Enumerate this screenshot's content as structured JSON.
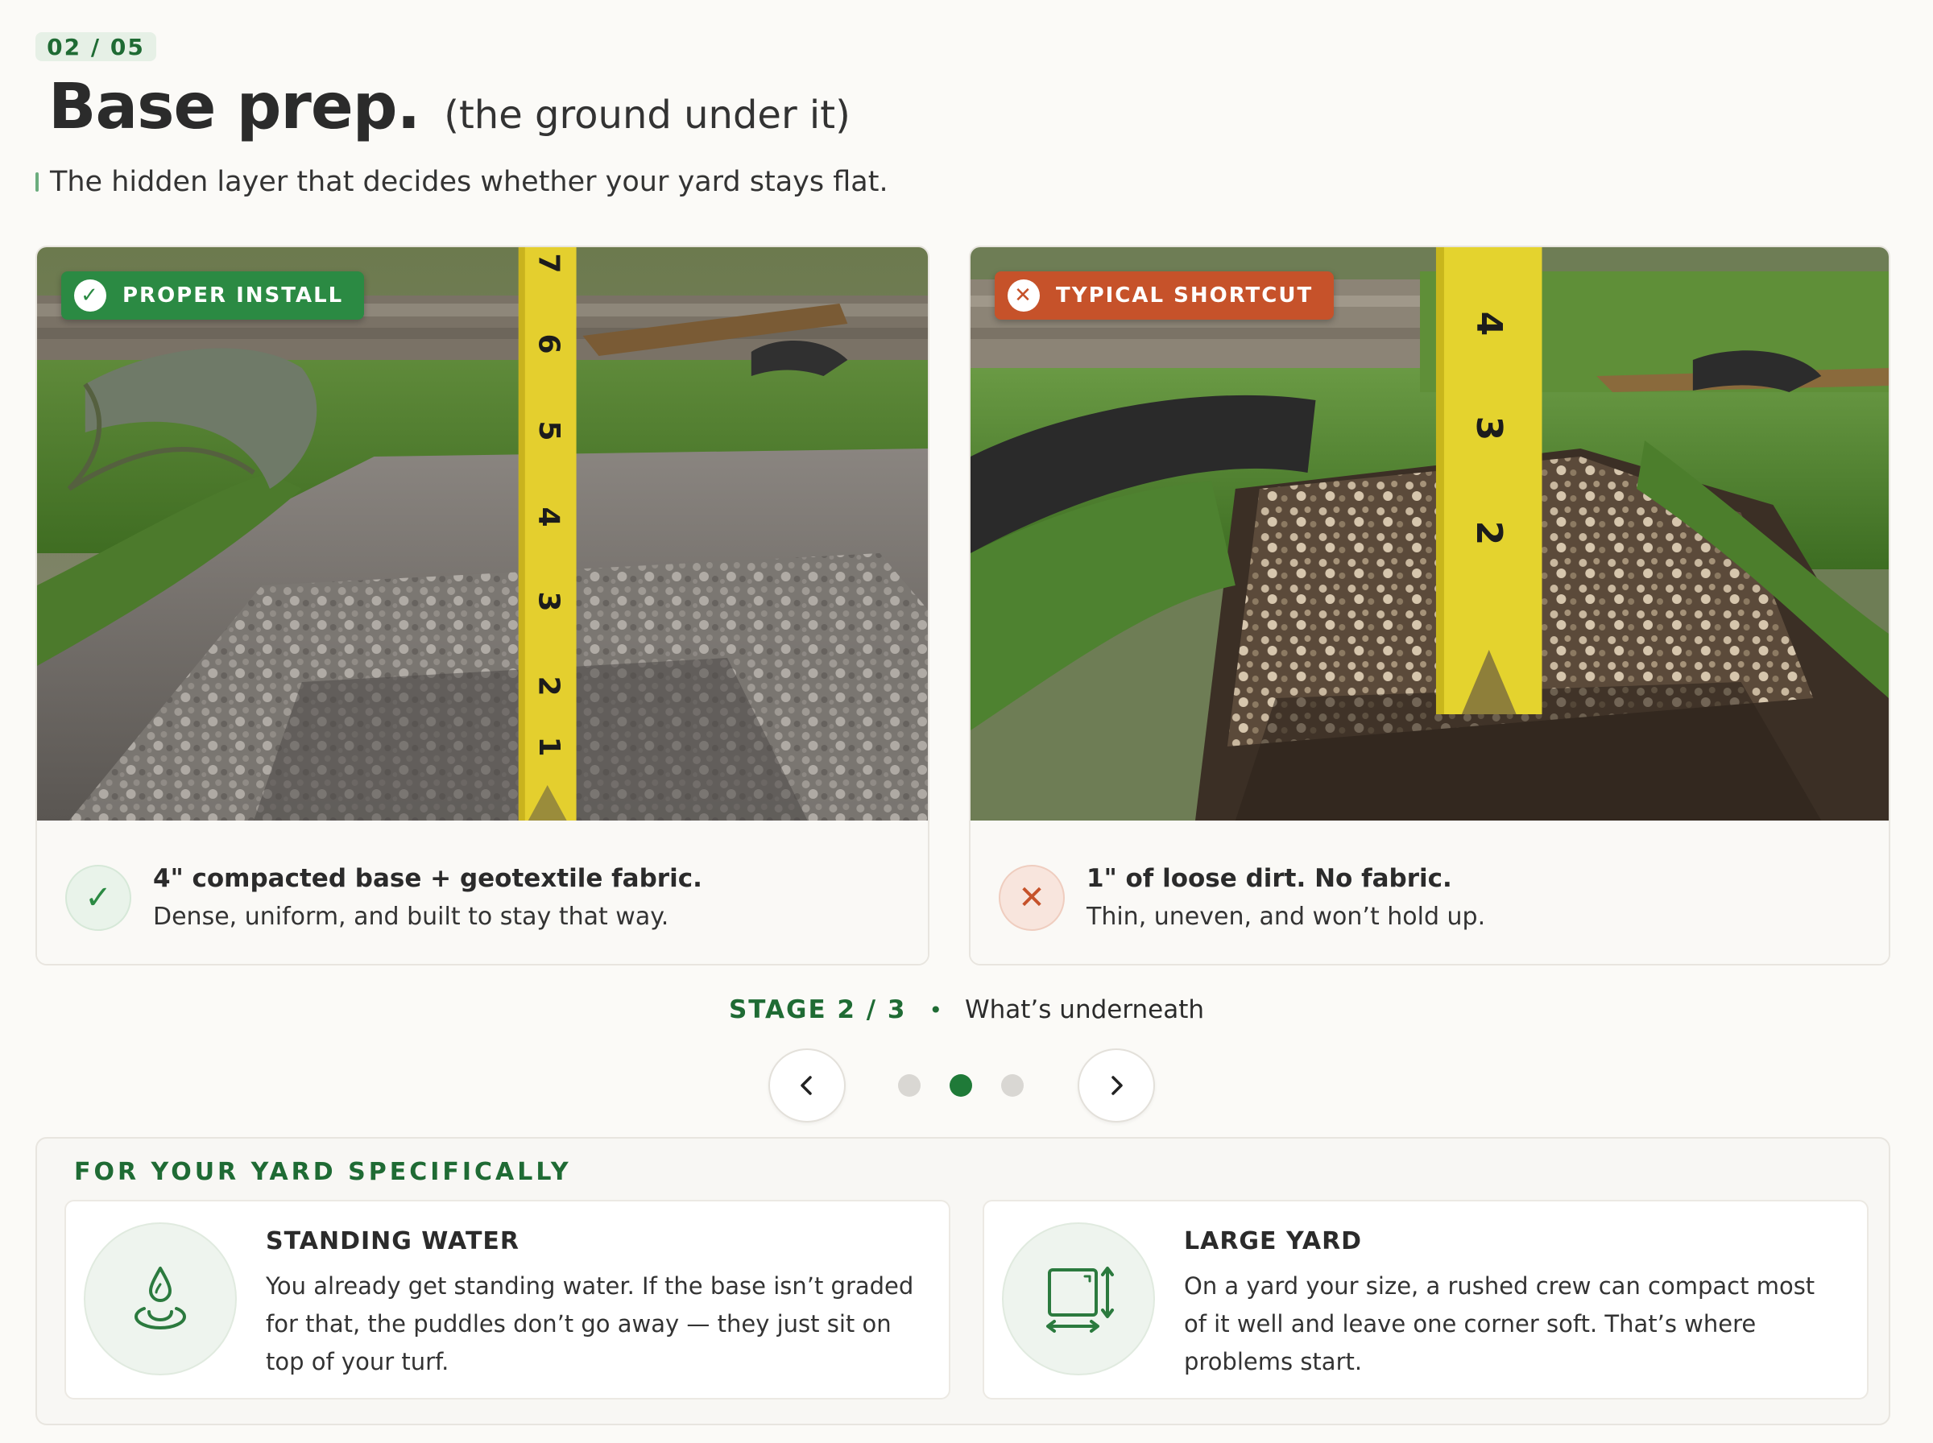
{
  "header": {
    "step": "02 / 05",
    "title": "Base prep.",
    "title_aside": "(the ground under it)",
    "subtitle": "The hidden layer that decides whether your yard stays flat."
  },
  "compare": {
    "proper": {
      "tag": "PROPER INSTALL",
      "tag_icon": "check-icon",
      "caption_head": "4\" compacted base + geotextile fabric.",
      "caption_body": "Dense, uniform, and built to stay that way.",
      "tape_numbers": [
        "7",
        "6",
        "5",
        "4",
        "3",
        "2",
        "1"
      ],
      "color": "#2b8a43"
    },
    "shortcut": {
      "tag": "TYPICAL SHORTCUT",
      "tag_icon": "x-icon",
      "caption_head": "1\" of loose dirt. No fabric.",
      "caption_body": "Thin, uneven, and won’t hold up.",
      "tape_numbers": [
        "4",
        "3",
        "2"
      ],
      "color": "#c6522a"
    }
  },
  "stage": {
    "number": "STAGE 2 / 3",
    "separator": "•",
    "label": "What’s underneath",
    "current": 2,
    "total": 3
  },
  "yard": {
    "title": "FOR YOUR YARD SPECIFICALLY",
    "items": [
      {
        "icon": "water-drop-icon",
        "head": "STANDING WATER",
        "body": "You already get standing water. If the base isn’t graded for that, the puddles don’t go away — they just sit on top of your turf."
      },
      {
        "icon": "yard-size-icon",
        "head": "LARGE YARD",
        "body": "On a yard your size, a rushed crew can compact most of it well and leave one corner soft. That’s where problems start."
      }
    ]
  },
  "colors": {
    "accent": "#1f6b34",
    "good": "#2b8a43",
    "bad": "#c6522a",
    "background": "#fbfaf7"
  }
}
